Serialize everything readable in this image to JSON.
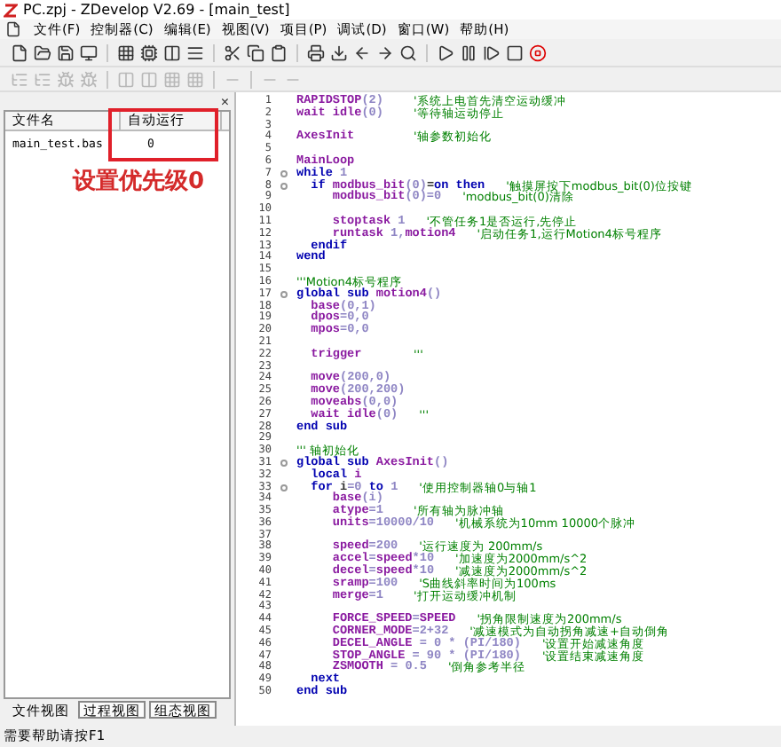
{
  "window": {
    "title": "PC.zpj - ZDevelop V2.69 - [main_test]"
  },
  "menu": [
    "文件(F)",
    "控制器(C)",
    "编辑(E)",
    "视图(V)",
    "项目(P)",
    "调试(D)",
    "窗口(W)",
    "帮助(H)"
  ],
  "file_panel": {
    "close": "×",
    "columns": [
      "文件名",
      "自动运行"
    ],
    "rows": [
      {
        "name": "main_test.bas",
        "auto_run": "0"
      }
    ],
    "annotation": "设置优先级0",
    "tabs": [
      {
        "label": "文件视图",
        "selected": true
      },
      {
        "label": "过程视图",
        "selected": false
      },
      {
        "label": "组态视图",
        "selected": false
      }
    ]
  },
  "editor": {
    "lines": [
      {
        "number": "1",
        "fold": false,
        "code": [
          {
            "kind": "fn",
            "text": "RAPIDSTOP"
          },
          {
            "kind": "num",
            "text": "(2)"
          }
        ],
        "comment": "'系统上电首先清空运动缓冲"
      },
      {
        "number": "2",
        "fold": false,
        "code": [
          {
            "kind": "fn",
            "text": "wait idle"
          },
          {
            "kind": "num",
            "text": "(0)"
          }
        ],
        "comment": "'等待轴运动停止"
      },
      {
        "number": "3",
        "fold": false
      },
      {
        "number": "4",
        "fold": false,
        "code": [
          {
            "kind": "fn",
            "text": "AxesInit"
          }
        ],
        "comment": "'轴参数初始化"
      },
      {
        "number": "5",
        "fold": false
      },
      {
        "number": "6",
        "fold": false,
        "code": [
          {
            "kind": "fn",
            "text": "MainLoop"
          }
        ]
      },
      {
        "number": "7",
        "fold": true,
        "code": [
          {
            "kind": "kw",
            "text": "while "
          },
          {
            "kind": "num",
            "text": "1"
          }
        ]
      },
      {
        "number": "8",
        "fold": true,
        "code": [
          {
            "kind": "kw",
            "text": "  if "
          },
          {
            "kind": "fn",
            "text": "modbus_bit"
          },
          {
            "kind": "num",
            "text": "(0)"
          },
          {
            "kind": "plain",
            "text": "="
          },
          {
            "kind": "kw",
            "text": "on then"
          }
        ],
        "comment": "'触摸屏按下modbus_bit(0)位按键"
      },
      {
        "number": "9",
        "fold": false,
        "code": [
          {
            "kind": "fn",
            "text": "     modbus_bit"
          },
          {
            "kind": "num",
            "text": "(0)=0"
          }
        ],
        "comment": "'modbus_bit(0)清除"
      },
      {
        "number": "10",
        "fold": false
      },
      {
        "number": "11",
        "fold": false,
        "code": [
          {
            "kind": "fn",
            "text": "     stoptask "
          },
          {
            "kind": "num",
            "text": "1"
          }
        ],
        "comment": "'不管任务1是否运行,先停止"
      },
      {
        "number": "12",
        "fold": false,
        "code": [
          {
            "kind": "fn",
            "text": "     runtask "
          },
          {
            "kind": "num",
            "text": "1,"
          },
          {
            "kind": "fn",
            "text": "motion4"
          }
        ],
        "comment": "'启动任务1,运行Motion4标号程序"
      },
      {
        "number": "13",
        "fold": false,
        "code": [
          {
            "kind": "kw",
            "text": "  endif"
          }
        ]
      },
      {
        "number": "14",
        "fold": false,
        "code": [
          {
            "kind": "kw",
            "text": "wend"
          }
        ]
      },
      {
        "number": "15",
        "fold": false
      },
      {
        "number": "16",
        "fold": false,
        "comment": "'''Motion4标号程序"
      },
      {
        "number": "17",
        "fold": true,
        "code": [
          {
            "kind": "kw",
            "text": "global sub "
          },
          {
            "kind": "fn",
            "text": "motion4"
          },
          {
            "kind": "num",
            "text": "()"
          }
        ]
      },
      {
        "number": "18",
        "fold": false,
        "code": [
          {
            "kind": "fn",
            "text": "  base"
          },
          {
            "kind": "num",
            "text": "(0,1)"
          }
        ]
      },
      {
        "number": "19",
        "fold": false,
        "code": [
          {
            "kind": "fn",
            "text": "  dpos"
          },
          {
            "kind": "num",
            "text": "=0,0"
          }
        ]
      },
      {
        "number": "20",
        "fold": false,
        "code": [
          {
            "kind": "fn",
            "text": "  mpos"
          },
          {
            "kind": "num",
            "text": "=0,0"
          }
        ]
      },
      {
        "number": "21",
        "fold": false
      },
      {
        "number": "22",
        "fold": false,
        "code": [
          {
            "kind": "fn",
            "text": "  trigger"
          }
        ],
        "comment": "'''"
      },
      {
        "number": "23",
        "fold": false
      },
      {
        "number": "24",
        "fold": false,
        "code": [
          {
            "kind": "fn",
            "text": "  move"
          },
          {
            "kind": "num",
            "text": "(200,0)"
          }
        ]
      },
      {
        "number": "25",
        "fold": false,
        "code": [
          {
            "kind": "fn",
            "text": "  move"
          },
          {
            "kind": "num",
            "text": "(200,200)"
          }
        ]
      },
      {
        "number": "26",
        "fold": false,
        "code": [
          {
            "kind": "fn",
            "text": "  moveabs"
          },
          {
            "kind": "num",
            "text": "(0,0)"
          }
        ]
      },
      {
        "number": "27",
        "fold": false,
        "code": [
          {
            "kind": "fn",
            "text": "  wait idle"
          },
          {
            "kind": "num",
            "text": "(0)"
          }
        ],
        "comment": "'''"
      },
      {
        "number": "28",
        "fold": false,
        "code": [
          {
            "kind": "kw",
            "text": "end sub"
          }
        ]
      },
      {
        "number": "29",
        "fold": false
      },
      {
        "number": "30",
        "fold": false,
        "comment": "''' 轴初始化"
      },
      {
        "number": "31",
        "fold": true,
        "code": [
          {
            "kind": "kw",
            "text": "global sub "
          },
          {
            "kind": "fn",
            "text": "AxesInit"
          },
          {
            "kind": "num",
            "text": "()"
          }
        ]
      },
      {
        "number": "32",
        "fold": false,
        "code": [
          {
            "kind": "kw",
            "text": "  local "
          },
          {
            "kind": "fn",
            "text": "i"
          }
        ]
      },
      {
        "number": "33",
        "fold": true,
        "code": [
          {
            "kind": "kw",
            "text": "  for "
          },
          {
            "kind": "plain",
            "text": "i"
          },
          {
            "kind": "num",
            "text": "=0 "
          },
          {
            "kind": "kw",
            "text": "to "
          },
          {
            "kind": "num",
            "text": "1"
          }
        ],
        "comment": "'使用控制器轴0与轴1"
      },
      {
        "number": "34",
        "fold": false,
        "code": [
          {
            "kind": "fn",
            "text": "     base"
          },
          {
            "kind": "num",
            "text": "(i)"
          }
        ]
      },
      {
        "number": "35",
        "fold": false,
        "code": [
          {
            "kind": "fn",
            "text": "     atype"
          },
          {
            "kind": "num",
            "text": "=1"
          }
        ],
        "comment": "'所有轴为脉冲轴"
      },
      {
        "number": "36",
        "fold": false,
        "code": [
          {
            "kind": "fn",
            "text": "     units"
          },
          {
            "kind": "num",
            "text": "=10000/10"
          }
        ],
        "comment": "'机械系统为10mm 10000个脉冲"
      },
      {
        "number": "37",
        "fold": false
      },
      {
        "number": "38",
        "fold": false,
        "code": [
          {
            "kind": "fn",
            "text": "     speed"
          },
          {
            "kind": "num",
            "text": "=200"
          }
        ],
        "comment": "'运行速度为 200mm/s"
      },
      {
        "number": "39",
        "fold": false,
        "code": [
          {
            "kind": "fn",
            "text": "     accel"
          },
          {
            "kind": "num",
            "text": "="
          },
          {
            "kind": "fn",
            "text": "speed"
          },
          {
            "kind": "num",
            "text": "*10"
          }
        ],
        "comment": "'加速度为2000mm/s^2"
      },
      {
        "number": "40",
        "fold": false,
        "code": [
          {
            "kind": "fn",
            "text": "     decel"
          },
          {
            "kind": "num",
            "text": "="
          },
          {
            "kind": "fn",
            "text": "speed"
          },
          {
            "kind": "num",
            "text": "*10"
          }
        ],
        "comment": "'减速度为2000mm/s^2"
      },
      {
        "number": "41",
        "fold": false,
        "code": [
          {
            "kind": "fn",
            "text": "     sramp"
          },
          {
            "kind": "num",
            "text": "=100"
          }
        ],
        "comment": "'S曲线斜率时间为100ms"
      },
      {
        "number": "42",
        "fold": false,
        "code": [
          {
            "kind": "fn",
            "text": "     merge"
          },
          {
            "kind": "num",
            "text": "=1"
          }
        ],
        "comment": "'打开运动缓冲机制"
      },
      {
        "number": "43",
        "fold": false
      },
      {
        "number": "44",
        "fold": false,
        "code": [
          {
            "kind": "fn",
            "text": "     FORCE_SPEED"
          },
          {
            "kind": "num",
            "text": "="
          },
          {
            "kind": "fn",
            "text": "SPEED"
          }
        ],
        "comment": "'拐角限制速度为200mm/s"
      },
      {
        "number": "45",
        "fold": false,
        "code": [
          {
            "kind": "fn",
            "text": "     CORNER_MODE"
          },
          {
            "kind": "num",
            "text": "=2+32"
          }
        ],
        "comment": "'减速模式为自动拐角减速+自动倒角"
      },
      {
        "number": "46",
        "fold": false,
        "code": [
          {
            "kind": "fn",
            "text": "     DECEL_ANGLE"
          },
          {
            "kind": "num",
            "text": " = 0 * (PI/180)"
          }
        ],
        "comment": "'设置开始减速角度"
      },
      {
        "number": "47",
        "fold": false,
        "code": [
          {
            "kind": "fn",
            "text": "     STOP_ANGLE"
          },
          {
            "kind": "num",
            "text": " = 90 * (PI/180)"
          }
        ],
        "comment": "'设置结束减速角度"
      },
      {
        "number": "48",
        "fold": false,
        "code": [
          {
            "kind": "fn",
            "text": "     ZSMOOTH"
          },
          {
            "kind": "num",
            "text": " = 0.5"
          }
        ],
        "comment": "'倒角参考半径"
      },
      {
        "number": "49",
        "fold": false,
        "code": [
          {
            "kind": "kw",
            "text": "  next"
          }
        ]
      },
      {
        "number": "50",
        "fold": false,
        "code": [
          {
            "kind": "kw",
            "text": "end sub"
          }
        ]
      }
    ]
  },
  "status_bar": "需要帮助请按F1"
}
